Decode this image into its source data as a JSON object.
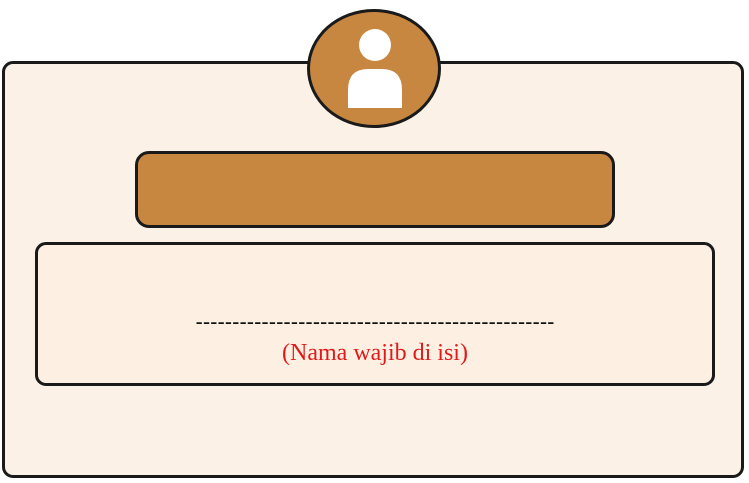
{
  "form": {
    "name_line": "-------------------------------------------------",
    "name_hint": "(Nama wajib di isi)"
  },
  "colors": {
    "accent": "#c78741",
    "card_background": "#fbf1e6",
    "panel_background": "#fdf0e2",
    "border": "#1a1a1a",
    "hint_text": "#e01a1a"
  },
  "icons": {
    "avatar": "user-icon"
  }
}
